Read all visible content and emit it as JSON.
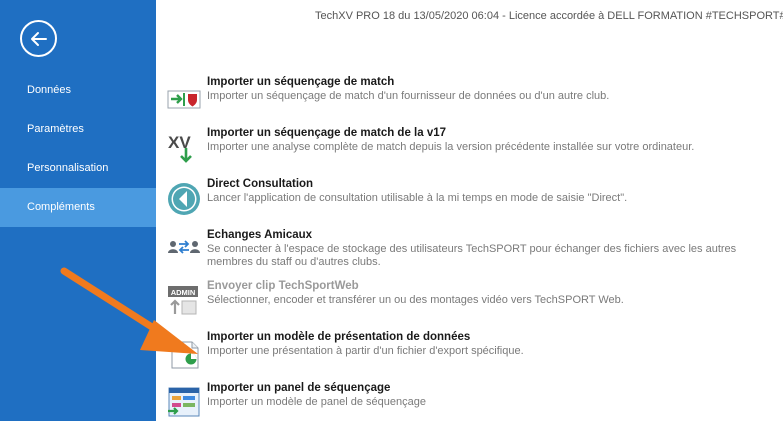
{
  "window": {
    "title": "TechXV PRO 18 du 13/05/2020 06:04  - Licence accordée à DELL FORMATION #TECHSPORT#"
  },
  "sidebar": {
    "items": [
      {
        "label": "Données"
      },
      {
        "label": "Paramètres"
      },
      {
        "label": "Personnalisation"
      },
      {
        "label": "Compléments",
        "active": true
      }
    ]
  },
  "actions": [
    {
      "title": "Importer un séquençage de match",
      "desc": "Importer un séquençage de match d'un fournisseur de données ou d'un autre club.",
      "icon": "import-match-icon"
    },
    {
      "title": "Importer un séquençage de match de la v17",
      "desc": "Importer une analyse complète de match depuis la version précédente installée sur votre ordinateur.",
      "icon": "xv-import-icon"
    },
    {
      "title": "Direct Consultation",
      "desc": "Lancer l'application de consultation utilisable à la mi temps en mode de saisie \"Direct\".",
      "icon": "direct-consultation-icon"
    },
    {
      "title": "Echanges Amicaux",
      "desc": "Se connecter à l'espace de stockage des utilisateurs TechSPORT pour échanger des fichiers avec les autres membres du staff ou d'autres clubs.",
      "icon": "users-exchange-icon"
    },
    {
      "title": "Envoyer clip TechSportWeb",
      "desc": "Sélectionner, encoder et transférer un ou des montages vidéo vers TechSPORT Web.",
      "icon": "admin-upload-icon",
      "disabled": true
    },
    {
      "title": "Importer un modèle de présentation de données",
      "desc": "Importer une présentation à partir d'un fichier d'export spécifique.",
      "icon": "presentation-import-icon"
    },
    {
      "title": "Importer un panel de séquençage",
      "desc": "Importer un modèle de panel de séquençage",
      "icon": "panel-import-icon"
    }
  ],
  "colors": {
    "sidebar": "#1f6fc2",
    "sidebar_active": "#4a9ae0",
    "annotation_arrow": "#f07a1e"
  }
}
